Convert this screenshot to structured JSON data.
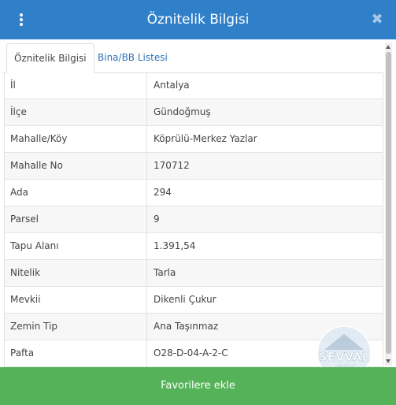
{
  "header": {
    "title": "Öznitelik Bilgisi",
    "close_symbol": "✖"
  },
  "tabs": [
    {
      "label": "Öznitelik Bilgisi",
      "active": true
    },
    {
      "label": "Bina/BB Listesi",
      "active": false
    }
  ],
  "attributes": [
    {
      "key": "İl",
      "value": "Antalya"
    },
    {
      "key": "İlçe",
      "value": "Gündoğmuş"
    },
    {
      "key": "Mahalle/Köy",
      "value": "Köprülü-Merkez Yazlar"
    },
    {
      "key": "Mahalle No",
      "value": "170712"
    },
    {
      "key": "Ada",
      "value": "294"
    },
    {
      "key": "Parsel",
      "value": "9"
    },
    {
      "key": "Tapu Alanı",
      "value": "1.391,54"
    },
    {
      "key": "Nitelik",
      "value": "Tarla"
    },
    {
      "key": "Mevkii",
      "value": "Dikenli Çukur"
    },
    {
      "key": "Zemin Tip",
      "value": "Ana Taşınmaz"
    },
    {
      "key": "Pafta",
      "value": "O28-D-04-A-2-C"
    }
  ],
  "footer": {
    "button_label": "Favorilere ekle"
  },
  "watermark": {
    "text": "SEVVAL",
    "subtext": ".COM"
  },
  "icons": {
    "menu": "kebab-menu-icon",
    "close": "close-icon"
  },
  "colors": {
    "header": "#2f80c9",
    "footer": "#55b258",
    "link": "#2f73b5"
  }
}
